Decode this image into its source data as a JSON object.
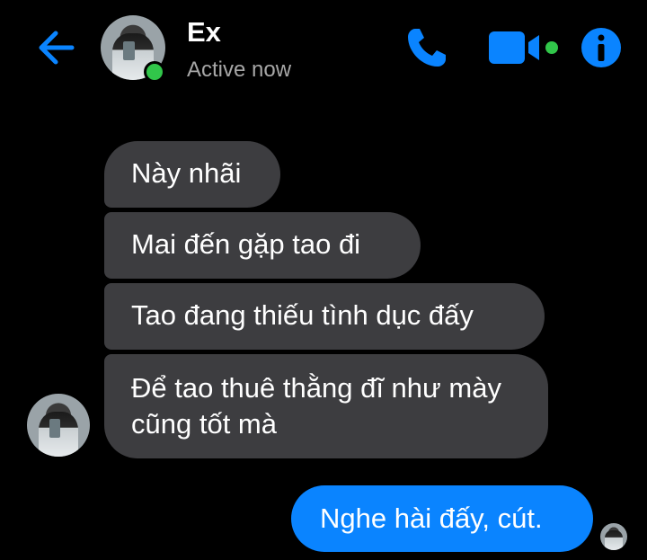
{
  "header": {
    "contact_name": "Ex",
    "status": "Active now",
    "accent_color": "#0a84ff",
    "icons": {
      "back": "back-arrow-icon",
      "call": "phone-icon",
      "video": "video-camera-icon",
      "info": "info-icon"
    }
  },
  "messages": {
    "incoming": [
      "Này nhãi",
      "Mai đến gặp tao đi",
      "Tao đang thiếu tình dục đấy",
      "Để tao thuê thằng đĩ như mày cũng tốt mà"
    ],
    "outgoing": [
      "Nghe hài đấy, cút."
    ]
  }
}
